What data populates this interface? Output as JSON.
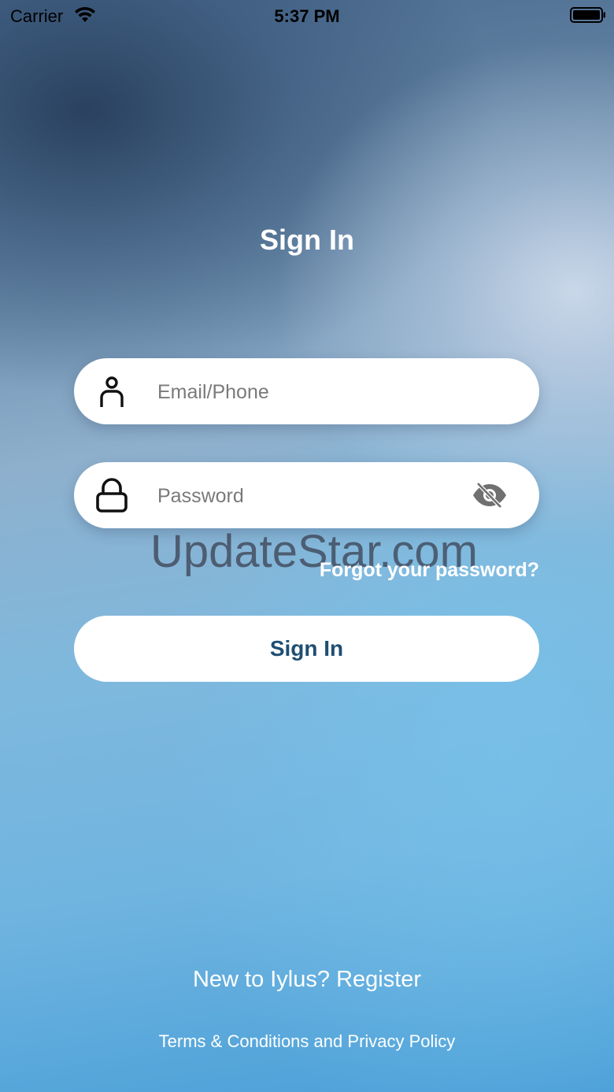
{
  "status_bar": {
    "carrier": "Carrier",
    "time": "5:37 PM"
  },
  "title": "Sign In",
  "email_field": {
    "placeholder": "Email/Phone",
    "value": "",
    "icon": "user-icon"
  },
  "password_field": {
    "placeholder": "Password",
    "value": "",
    "icon": "lock-icon",
    "toggle_icon": "eye-slash-icon"
  },
  "watermark": "UpdateStar.com",
  "forgot_password": "Forgot your password?",
  "signin_button": "Sign In",
  "register": "New to Iylus? Register",
  "legal": {
    "terms": "Terms & Conditions",
    "conjunction": "and",
    "privacy": "Privacy Policy"
  },
  "colors": {
    "button_text": "#1f4e73",
    "white": "#ffffff"
  }
}
